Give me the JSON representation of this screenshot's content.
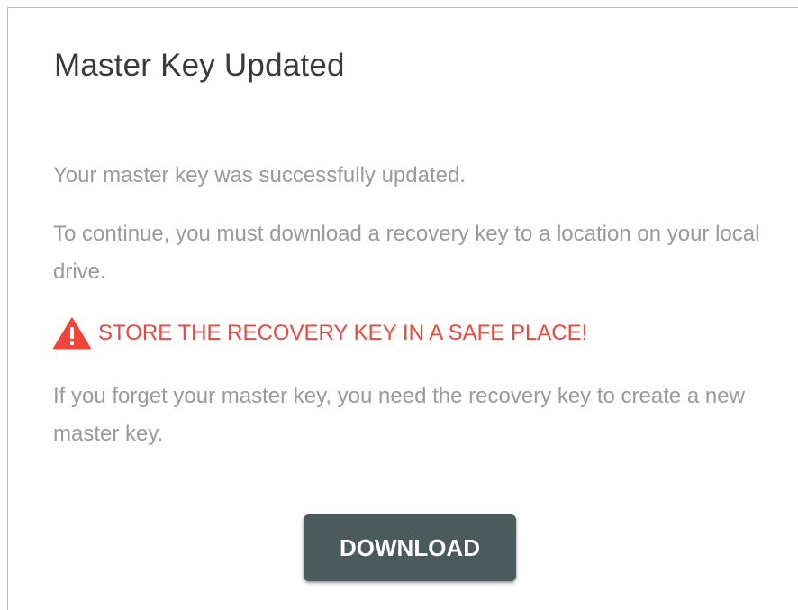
{
  "dialog": {
    "title": "Master Key Updated",
    "message_1": "Your master key was successfully updated.",
    "message_2": "To continue, you must download a recovery key to a location on your local drive.",
    "warning": {
      "icon": "warning-triangle-icon",
      "text": "STORE THE RECOVERY KEY IN A SAFE PLACE!",
      "color": "#f0453b"
    },
    "message_3": "If you forget your master key, you need the recovery key to create a new master key.",
    "download_button": {
      "label": "DOWNLOAD",
      "color": "#4b5a5a"
    }
  }
}
